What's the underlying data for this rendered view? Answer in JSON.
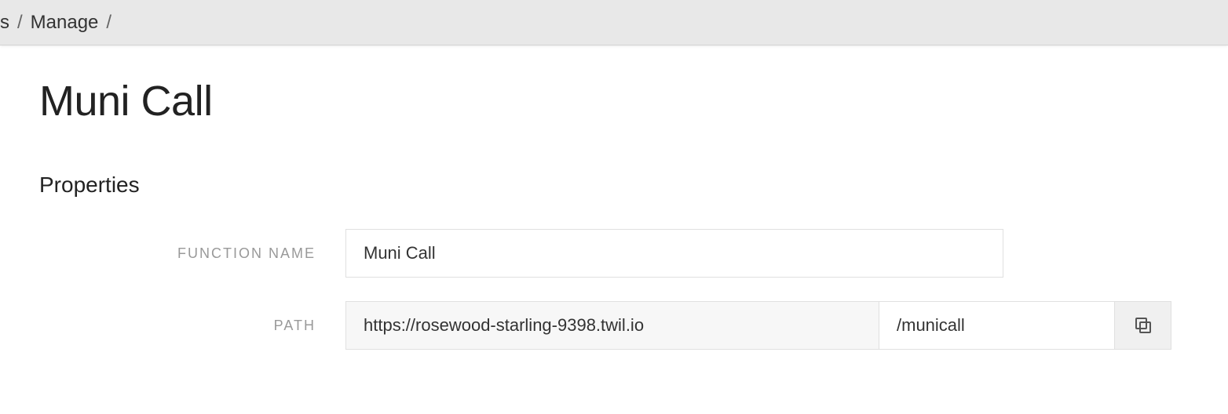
{
  "breadcrumb": {
    "prefix": "s",
    "sep": "/",
    "items": [
      "Manage"
    ]
  },
  "page": {
    "title": "Muni Call"
  },
  "properties": {
    "section_title": "Properties",
    "function_name_label": "FUNCTION NAME",
    "function_name_value": "Muni Call",
    "path_label": "PATH",
    "url_prefix": "https://rosewood-starling-9398.twil.io",
    "path_value": "/municall"
  }
}
